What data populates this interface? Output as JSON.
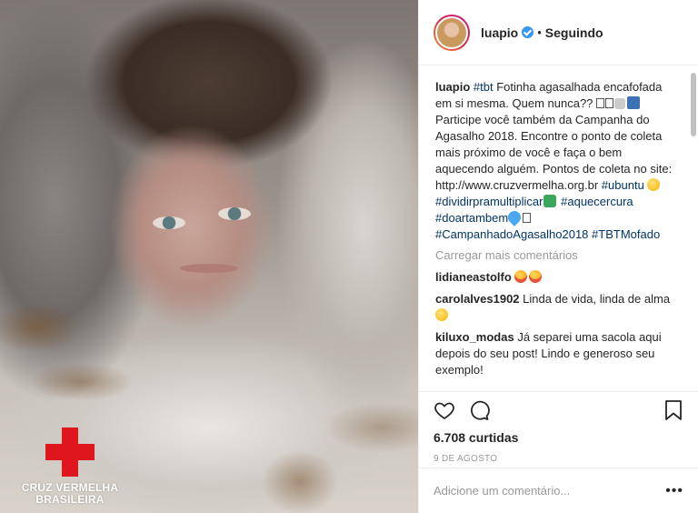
{
  "post": {
    "photo_logo_text": "CRUZ VERMELHA BRASILEIRA",
    "header": {
      "username": "luapio",
      "separator": "•",
      "follow_status": "Seguindo"
    },
    "caption": {
      "username": "luapio",
      "tag1": "#tbt",
      "text1": "Fotinha agasalhada encafofada em si mesma. Quem nunca??",
      "text2": "Participe você também da Campanha do Agasalho 2018. Encontre o ponto de coleta mais próximo de você e faça o bem aquecendo alguém. Pontos de coleta no site: http://www.cruzvermelha.org.br",
      "tag2": "#ubuntu",
      "tag3": "#dividirpramultiplicar",
      "tag4": "#aquecercura",
      "tag5": "#doartambem",
      "tag6": "#CampanhadoAgasalho2018",
      "tag7": "#TBTMofado"
    },
    "load_more": "Carregar mais comentários",
    "comments": [
      {
        "user": "lidianeastolfo",
        "text": ""
      },
      {
        "user": "carolalves1902",
        "text": "Linda de vida, linda de alma"
      },
      {
        "user": "kiluxo_modas",
        "text": "Já separei uma sacola aqui depois do seu post! Lindo e generoso seu exemplo!"
      }
    ],
    "likes": "6.708 curtidas",
    "date": "9 DE AGOSTO",
    "add_comment_placeholder": "Adicione um comentário...",
    "more_options": "•••"
  },
  "icons": {
    "like": "heart-icon",
    "comment": "comment-icon",
    "save": "bookmark-icon",
    "verified": "verified-badge-icon",
    "options": "more-icon"
  },
  "colors": {
    "hashtag": "#003569",
    "verified": "#3897f0",
    "red_cross": "#e0161e",
    "muted": "#999999"
  }
}
